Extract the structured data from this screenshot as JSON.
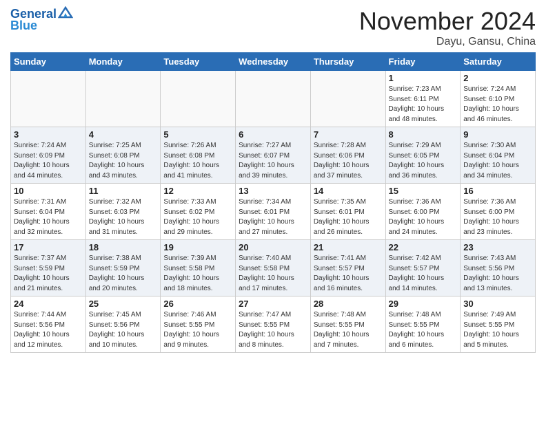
{
  "header": {
    "logo_line1": "General",
    "logo_line2": "Blue",
    "month_title": "November 2024",
    "location": "Dayu, Gansu, China"
  },
  "weekdays": [
    "Sunday",
    "Monday",
    "Tuesday",
    "Wednesday",
    "Thursday",
    "Friday",
    "Saturday"
  ],
  "weeks": [
    [
      {
        "day": "",
        "info": ""
      },
      {
        "day": "",
        "info": ""
      },
      {
        "day": "",
        "info": ""
      },
      {
        "day": "",
        "info": ""
      },
      {
        "day": "",
        "info": ""
      },
      {
        "day": "1",
        "info": "Sunrise: 7:23 AM\nSunset: 6:11 PM\nDaylight: 10 hours and 48 minutes."
      },
      {
        "day": "2",
        "info": "Sunrise: 7:24 AM\nSunset: 6:10 PM\nDaylight: 10 hours and 46 minutes."
      }
    ],
    [
      {
        "day": "3",
        "info": "Sunrise: 7:24 AM\nSunset: 6:09 PM\nDaylight: 10 hours and 44 minutes."
      },
      {
        "day": "4",
        "info": "Sunrise: 7:25 AM\nSunset: 6:08 PM\nDaylight: 10 hours and 43 minutes."
      },
      {
        "day": "5",
        "info": "Sunrise: 7:26 AM\nSunset: 6:08 PM\nDaylight: 10 hours and 41 minutes."
      },
      {
        "day": "6",
        "info": "Sunrise: 7:27 AM\nSunset: 6:07 PM\nDaylight: 10 hours and 39 minutes."
      },
      {
        "day": "7",
        "info": "Sunrise: 7:28 AM\nSunset: 6:06 PM\nDaylight: 10 hours and 37 minutes."
      },
      {
        "day": "8",
        "info": "Sunrise: 7:29 AM\nSunset: 6:05 PM\nDaylight: 10 hours and 36 minutes."
      },
      {
        "day": "9",
        "info": "Sunrise: 7:30 AM\nSunset: 6:04 PM\nDaylight: 10 hours and 34 minutes."
      }
    ],
    [
      {
        "day": "10",
        "info": "Sunrise: 7:31 AM\nSunset: 6:04 PM\nDaylight: 10 hours and 32 minutes."
      },
      {
        "day": "11",
        "info": "Sunrise: 7:32 AM\nSunset: 6:03 PM\nDaylight: 10 hours and 31 minutes."
      },
      {
        "day": "12",
        "info": "Sunrise: 7:33 AM\nSunset: 6:02 PM\nDaylight: 10 hours and 29 minutes."
      },
      {
        "day": "13",
        "info": "Sunrise: 7:34 AM\nSunset: 6:01 PM\nDaylight: 10 hours and 27 minutes."
      },
      {
        "day": "14",
        "info": "Sunrise: 7:35 AM\nSunset: 6:01 PM\nDaylight: 10 hours and 26 minutes."
      },
      {
        "day": "15",
        "info": "Sunrise: 7:36 AM\nSunset: 6:00 PM\nDaylight: 10 hours and 24 minutes."
      },
      {
        "day": "16",
        "info": "Sunrise: 7:36 AM\nSunset: 6:00 PM\nDaylight: 10 hours and 23 minutes."
      }
    ],
    [
      {
        "day": "17",
        "info": "Sunrise: 7:37 AM\nSunset: 5:59 PM\nDaylight: 10 hours and 21 minutes."
      },
      {
        "day": "18",
        "info": "Sunrise: 7:38 AM\nSunset: 5:59 PM\nDaylight: 10 hours and 20 minutes."
      },
      {
        "day": "19",
        "info": "Sunrise: 7:39 AM\nSunset: 5:58 PM\nDaylight: 10 hours and 18 minutes."
      },
      {
        "day": "20",
        "info": "Sunrise: 7:40 AM\nSunset: 5:58 PM\nDaylight: 10 hours and 17 minutes."
      },
      {
        "day": "21",
        "info": "Sunrise: 7:41 AM\nSunset: 5:57 PM\nDaylight: 10 hours and 16 minutes."
      },
      {
        "day": "22",
        "info": "Sunrise: 7:42 AM\nSunset: 5:57 PM\nDaylight: 10 hours and 14 minutes."
      },
      {
        "day": "23",
        "info": "Sunrise: 7:43 AM\nSunset: 5:56 PM\nDaylight: 10 hours and 13 minutes."
      }
    ],
    [
      {
        "day": "24",
        "info": "Sunrise: 7:44 AM\nSunset: 5:56 PM\nDaylight: 10 hours and 12 minutes."
      },
      {
        "day": "25",
        "info": "Sunrise: 7:45 AM\nSunset: 5:56 PM\nDaylight: 10 hours and 10 minutes."
      },
      {
        "day": "26",
        "info": "Sunrise: 7:46 AM\nSunset: 5:55 PM\nDaylight: 10 hours and 9 minutes."
      },
      {
        "day": "27",
        "info": "Sunrise: 7:47 AM\nSunset: 5:55 PM\nDaylight: 10 hours and 8 minutes."
      },
      {
        "day": "28",
        "info": "Sunrise: 7:48 AM\nSunset: 5:55 PM\nDaylight: 10 hours and 7 minutes."
      },
      {
        "day": "29",
        "info": "Sunrise: 7:48 AM\nSunset: 5:55 PM\nDaylight: 10 hours and 6 minutes."
      },
      {
        "day": "30",
        "info": "Sunrise: 7:49 AM\nSunset: 5:55 PM\nDaylight: 10 hours and 5 minutes."
      }
    ]
  ]
}
